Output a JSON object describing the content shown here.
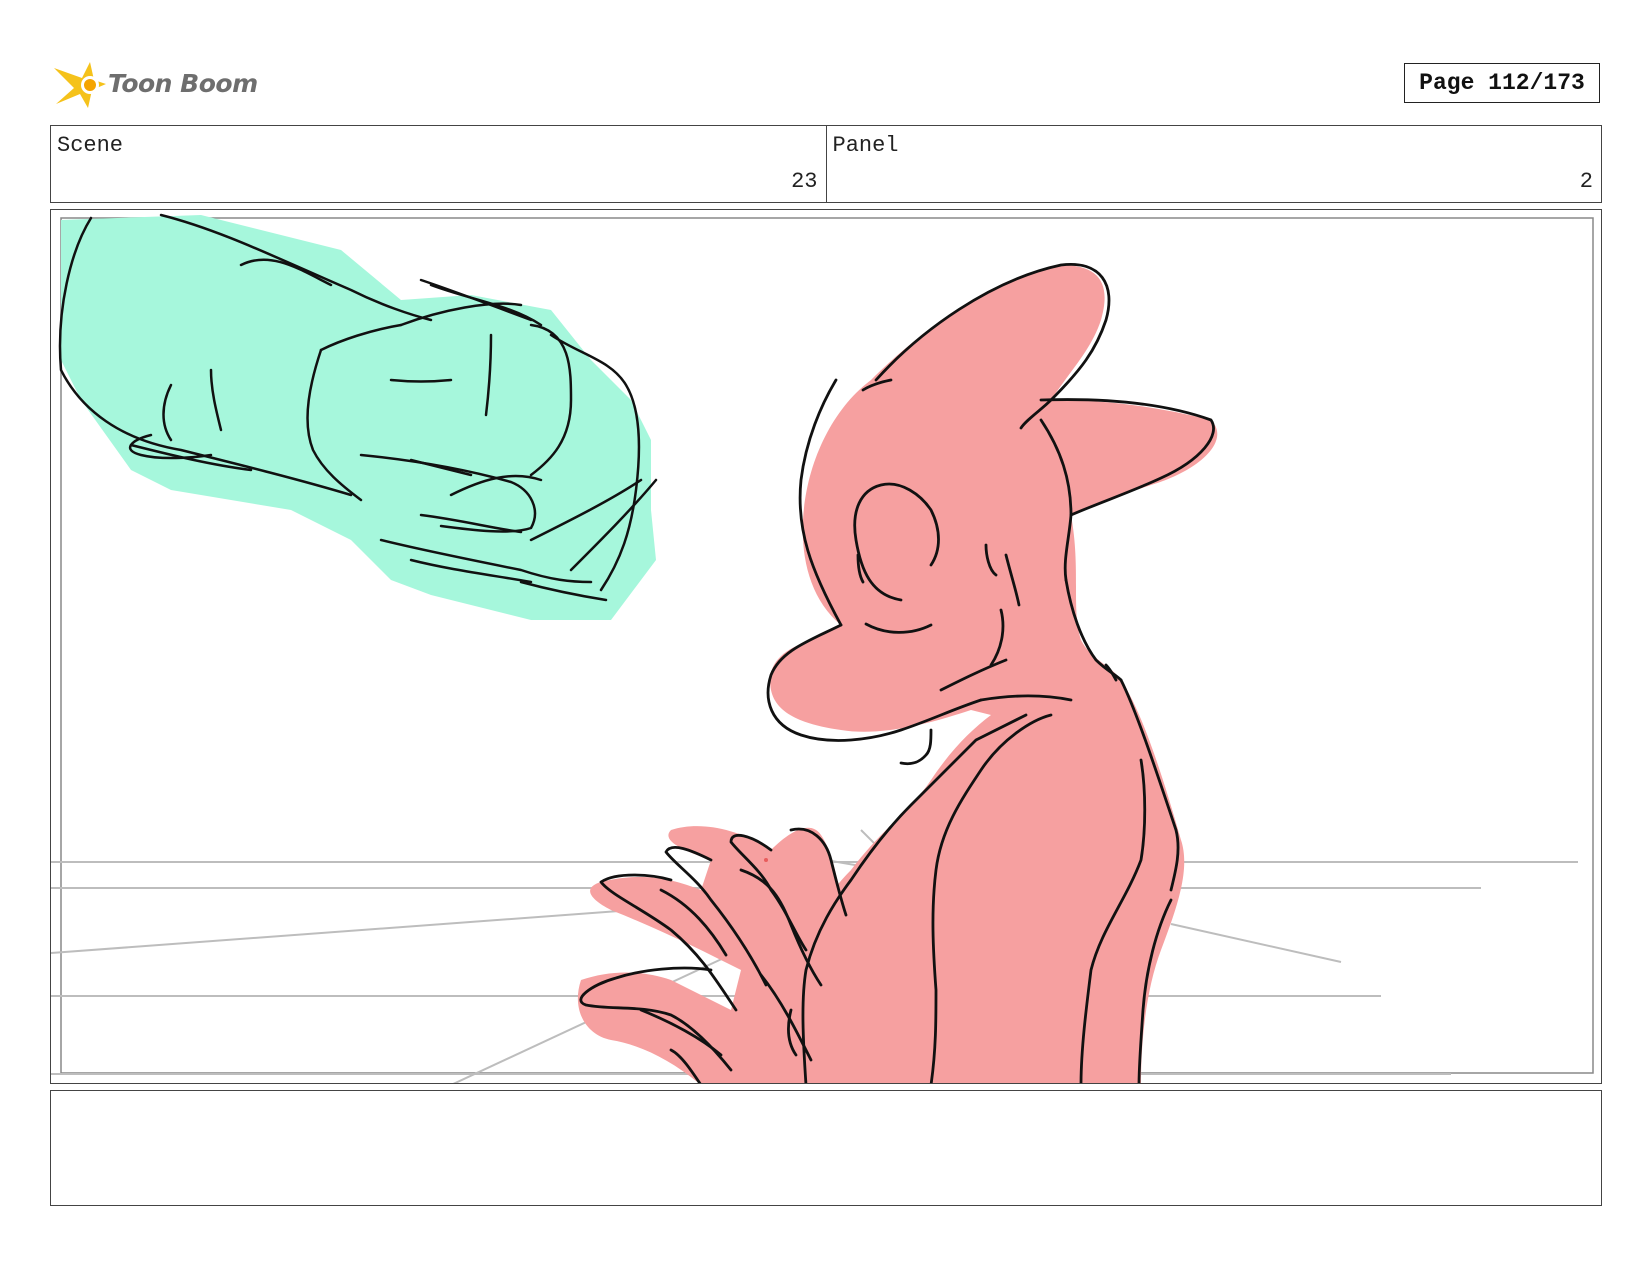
{
  "header": {
    "logo_text": "Toon Boom",
    "logo_icon": "comet-star-icon",
    "page_label": "Page 112/173"
  },
  "info": {
    "scene_label": "Scene",
    "scene_value": "23",
    "panel_label": "Panel",
    "panel_value": "2"
  },
  "panel": {
    "colors": {
      "fist": "#a6f7dc",
      "character": "#f6a0a0",
      "line": "#111111",
      "guide": "#bdbdbd"
    }
  },
  "notes": {
    "text": ""
  }
}
